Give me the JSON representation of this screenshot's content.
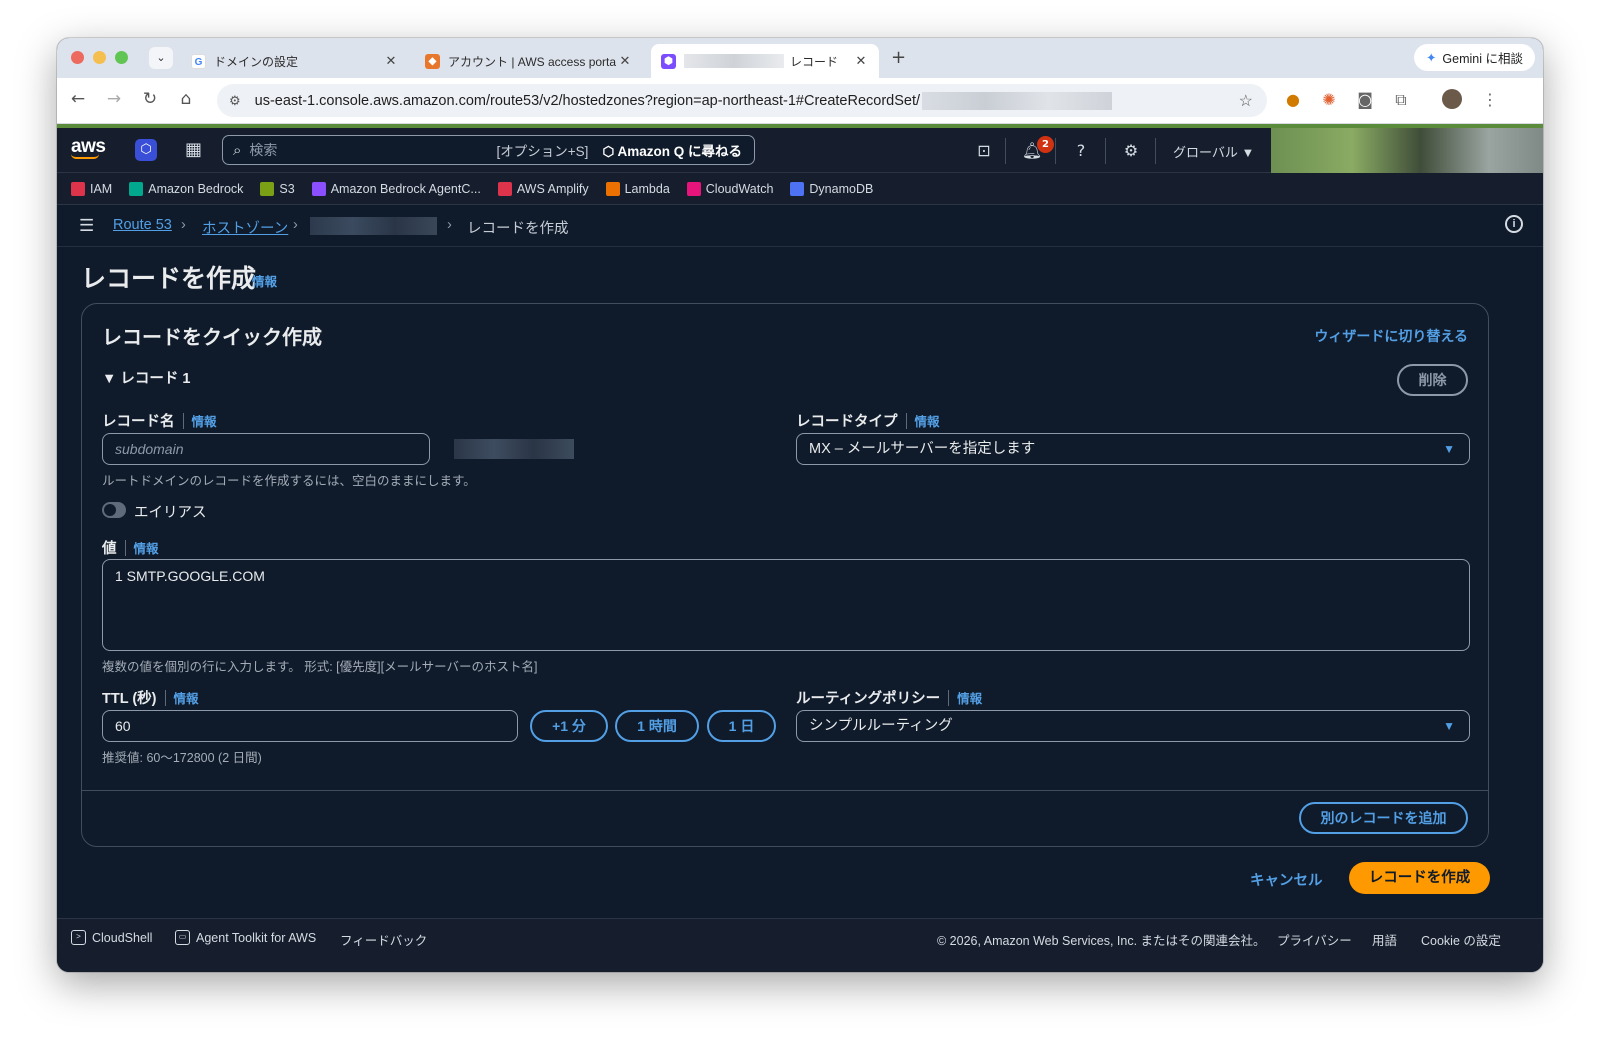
{
  "browser": {
    "tabs": [
      {
        "title": "ドメインの設定",
        "favicon": "google-icon"
      },
      {
        "title": "アカウント | AWS access porta",
        "favicon": "aws-cube-icon"
      },
      {
        "title": "レコード",
        "favicon": "route53-icon"
      }
    ],
    "gemini": "Gemini に相談",
    "url": "us-east-1.console.aws.amazon.com/route53/v2/hostedzones?region=ap-northeast-1#CreateRecordSet/"
  },
  "aws_header": {
    "logo": "aws",
    "search_placeholder": "検索",
    "shortcut": "[オプション+S]",
    "amazon_q": "Amazon Q に尋ねる",
    "notification_count": "2",
    "region": "グローバル ▼"
  },
  "favorites": [
    {
      "label": "IAM",
      "color": "#dd344c"
    },
    {
      "label": "Amazon Bedrock",
      "color": "#01a88d"
    },
    {
      "label": "S3",
      "color": "#7aa116"
    },
    {
      "label": "Amazon Bedrock AgentC...",
      "color": "#8c4fff"
    },
    {
      "label": "AWS Amplify",
      "color": "#dd344c"
    },
    {
      "label": "Lambda",
      "color": "#ed7100"
    },
    {
      "label": "CloudWatch",
      "color": "#e7157b"
    },
    {
      "label": "DynamoDB",
      "color": "#4d72f3"
    }
  ],
  "breadcrumb": {
    "route53": "Route 53",
    "hosted_zones": "ホストゾーン",
    "current": "レコードを作成"
  },
  "page": {
    "title": "レコードを作成",
    "info": "情報"
  },
  "panel": {
    "title": "レコードをクイック作成",
    "wizard_link": "ウィザードに切り替える",
    "record_header": "▼ レコード 1",
    "delete": "削除",
    "record_name_label": "レコード名",
    "record_name_placeholder": "subdomain",
    "record_name_hint": "ルートドメインのレコードを作成するには、空白のままにします。",
    "record_type_label": "レコードタイプ",
    "record_type_value": "MX – メールサーバーを指定します",
    "alias_label": "エイリアス",
    "value_label": "値",
    "value_text": "1 SMTP.GOOGLE.COM",
    "value_hint": "複数の値を個別の行に入力します。 形式: [優先度][メールサーバーのホスト名]",
    "ttl_label": "TTL (秒)",
    "ttl_value": "60",
    "ttl_btn_1m": "+1 分",
    "ttl_btn_1h": "1 時間",
    "ttl_btn_1d": "1 日",
    "ttl_hint": "推奨値: 60～172800 (2 日間)",
    "routing_label": "ルーティングポリシー",
    "routing_value": "シンプルルーティング",
    "add_record": "別のレコードを追加"
  },
  "actions": {
    "cancel": "キャンセル",
    "create": "レコードを作成"
  },
  "footer": {
    "cloudshell": "CloudShell",
    "agent_toolkit": "Agent Toolkit for AWS",
    "feedback": "フィードバック",
    "copyright": "© 2026, Amazon Web Services, Inc. またはその関連会社。",
    "privacy": "プライバシー",
    "terms": "用語",
    "cookie": "Cookie の設定"
  },
  "colors": {
    "accent_link": "#539fe5",
    "primary_button": "#ff9900",
    "background": "#0f1b2a"
  }
}
